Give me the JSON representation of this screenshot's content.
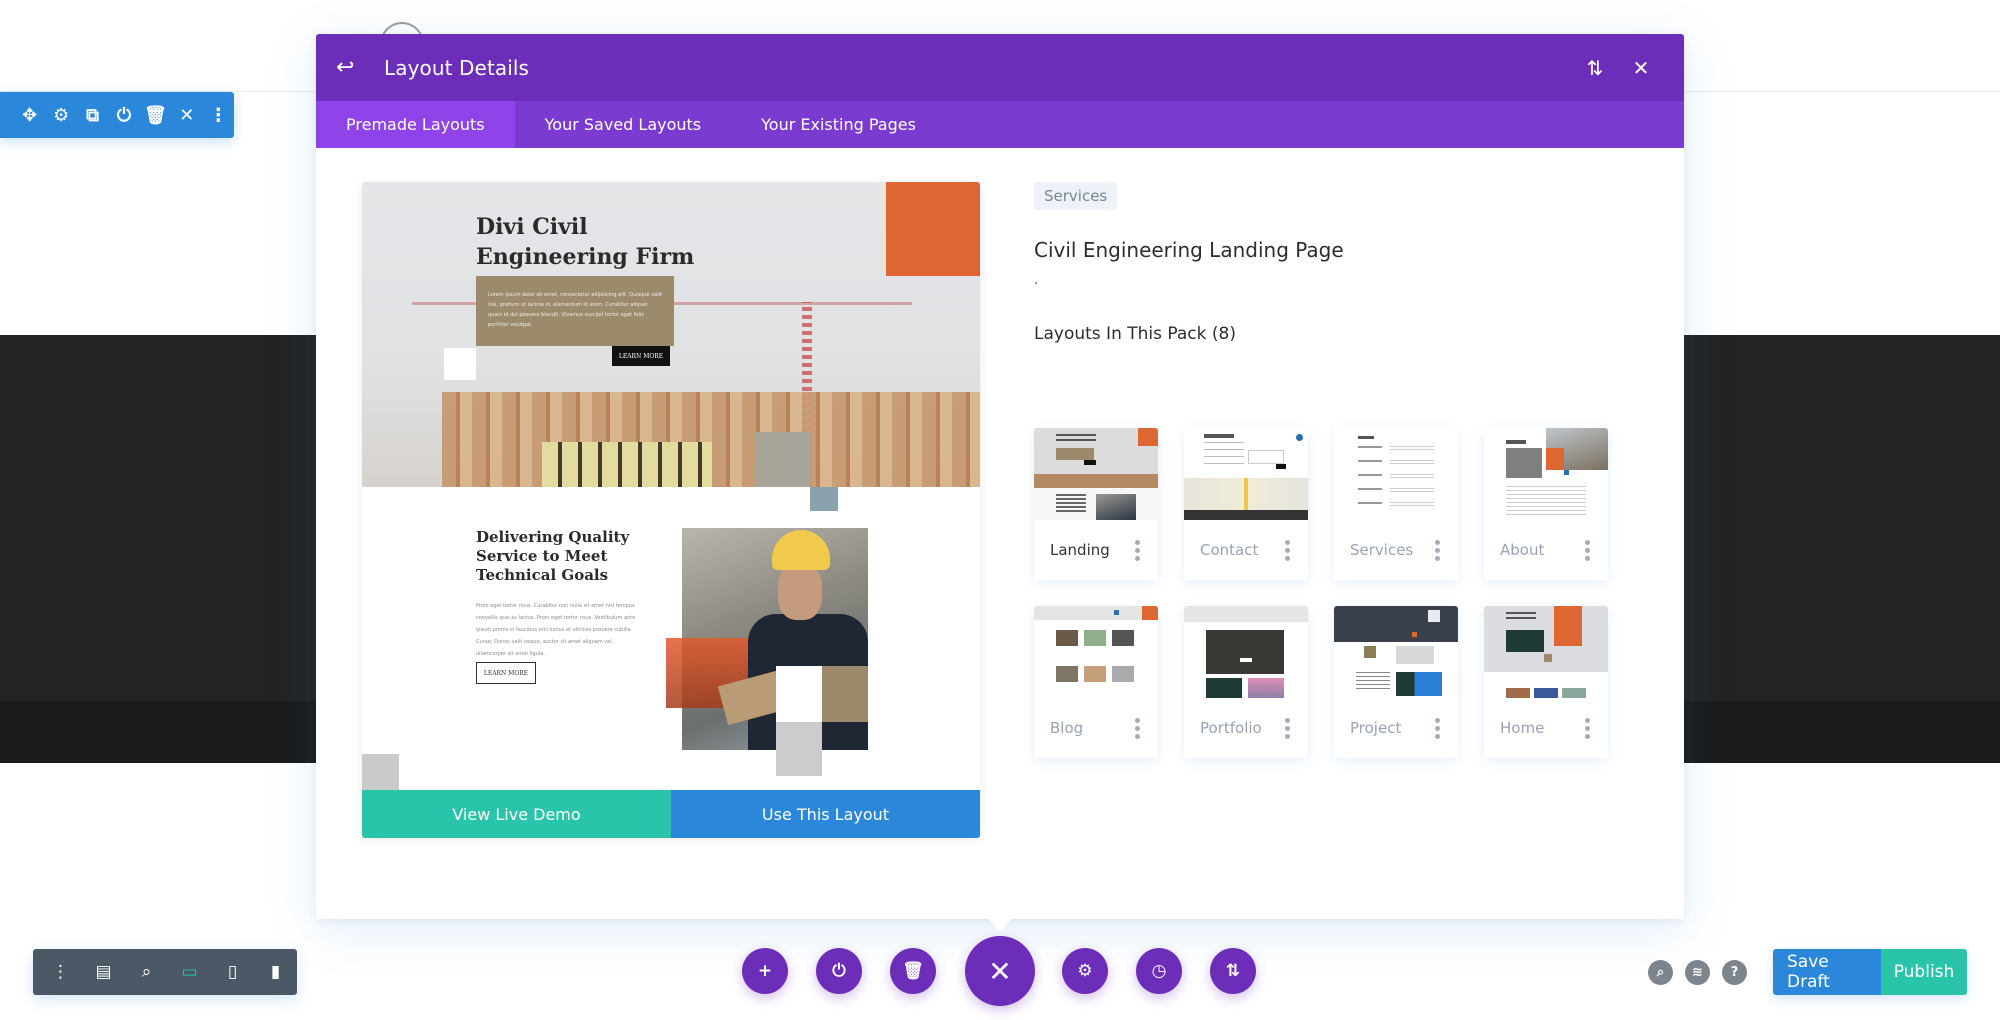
{
  "colors": {
    "modal_header": "#6c2eb9",
    "modal_tabs": "#7b3bd0",
    "active_tab": "#8e44e8",
    "section_toolbar": "#2b87da",
    "demo_button": "#29c4a9",
    "use_button": "#2b87da",
    "view_bar": "#4c5866",
    "fab": "#6c2eb9"
  },
  "section_toolbar": {
    "icons": [
      "move-icon",
      "gear-icon",
      "duplicate-icon",
      "save-to-library-icon",
      "trash-icon",
      "close-icon",
      "more-icon"
    ]
  },
  "modal": {
    "title": "Layout Details",
    "back_icon": "back-arrow-icon",
    "header_icons": [
      "sort-icon",
      "close-icon"
    ],
    "tabs": [
      {
        "label": "Premade Layouts",
        "active": true
      },
      {
        "label": "Your Saved Layouts",
        "active": false
      },
      {
        "label": "Your Existing Pages",
        "active": false
      }
    ],
    "preview": {
      "hero_title": "Divi Civil Engineering Firm",
      "hero_title_line1": "Divi Civil",
      "hero_title_line2": "Engineering Firm",
      "hero_body": "Lorem ipsum dolor sit amet, consectetur adipiscing elit. Quisque velit nisi, pretium ut lacinia in, elementum id enim. Curabitur aliquet quam id dui posuere blandit. Vivamus suscipit tortor eget felis porttitor volutpat.",
      "hero_button": "LEARN MORE",
      "section_title": "Delivering Quality Service to Meet Technical Goals",
      "section_body": "Proin eget tortor risus. Curabitur non nulla sit amet nisl tempus convallis quis ac lectus. Proin eget tortor risus. Vestibulum ante ipsum primis in faucibus orci luctus et ultrices posuere cubilia Curae; Donec velit neque, auctor sit amet aliquam vel, ullamcorper sit amet ligula.",
      "section_button": "LEARN MORE"
    },
    "actions": {
      "view_demo": "View Live Demo",
      "use_layout": "Use This Layout"
    },
    "details": {
      "category": "Services",
      "name": "Civil Engineering Landing Page",
      "description": ".",
      "pack_title": "Layouts In This Pack (8)"
    },
    "pack_layouts": [
      {
        "label": "Landing",
        "active": true
      },
      {
        "label": "Contact",
        "active": false
      },
      {
        "label": "Services",
        "active": false
      },
      {
        "label": "About",
        "active": false
      },
      {
        "label": "Blog",
        "active": false
      },
      {
        "label": "Portfolio",
        "active": false
      },
      {
        "label": "Project",
        "active": false
      },
      {
        "label": "Home",
        "active": false
      }
    ]
  },
  "view_bar": {
    "icons": [
      "more-icon",
      "wireframe-icon",
      "zoom-icon",
      "desktop-icon",
      "tablet-icon",
      "phone-icon"
    ],
    "active": "desktop-icon"
  },
  "bottom_actions": {
    "icons": [
      "add-icon",
      "load-icon",
      "trash-icon",
      "close-icon",
      "gear-icon",
      "history-icon",
      "sort-icon"
    ]
  },
  "help_icons": [
    "search-icon",
    "layers-icon",
    "help-icon"
  ],
  "publish": {
    "save_draft": "Save Draft",
    "publish": "Publish"
  }
}
